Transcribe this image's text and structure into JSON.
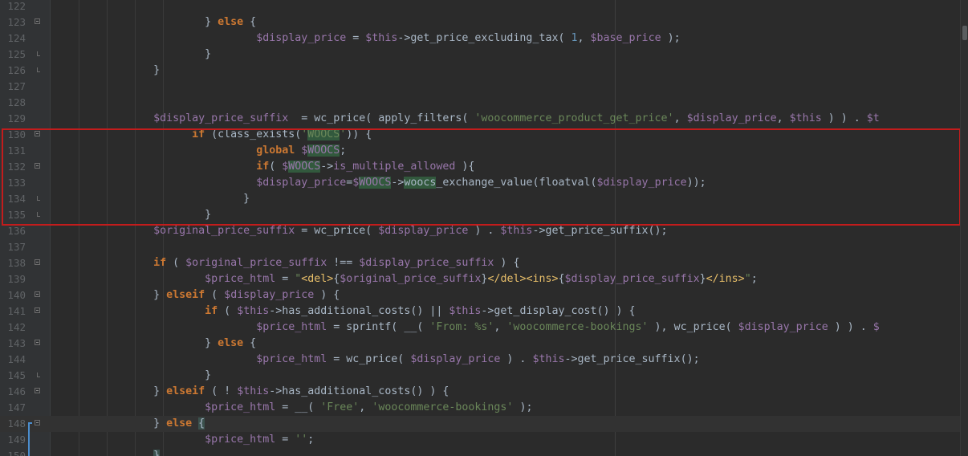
{
  "editor": {
    "lines": [
      {
        "n": "122",
        "fold": "none",
        "current": false,
        "tokens": []
      },
      {
        "n": "123",
        "fold": "start",
        "current": false,
        "tokens": [
          {
            "t": "                        } "
          },
          {
            "t": "else",
            "c": "kw"
          },
          {
            "t": " {"
          }
        ]
      },
      {
        "n": "124",
        "fold": "none",
        "current": false,
        "tokens": [
          {
            "t": "                                "
          },
          {
            "t": "$display_price",
            "c": "var"
          },
          {
            "t": " = "
          },
          {
            "t": "$this",
            "c": "var"
          },
          {
            "t": "->get_price_excluding_tax( "
          },
          {
            "t": "1",
            "c": "num"
          },
          {
            "t": ", "
          },
          {
            "t": "$base_price",
            "c": "var"
          },
          {
            "t": " );"
          }
        ]
      },
      {
        "n": "125",
        "fold": "end",
        "current": false,
        "tokens": [
          {
            "t": "                        }"
          }
        ]
      },
      {
        "n": "126",
        "fold": "end",
        "current": false,
        "tokens": [
          {
            "t": "                }"
          }
        ]
      },
      {
        "n": "127",
        "fold": "none",
        "current": false,
        "tokens": []
      },
      {
        "n": "128",
        "fold": "none",
        "current": false,
        "tokens": []
      },
      {
        "n": "129",
        "fold": "none",
        "current": false,
        "tokens": [
          {
            "t": "                "
          },
          {
            "t": "$display_price_suffix",
            "c": "var"
          },
          {
            "t": "  = wc_price( apply_filters( "
          },
          {
            "t": "'woocommerce_product_get_price'",
            "c": "str"
          },
          {
            "t": ", "
          },
          {
            "t": "$display_price",
            "c": "var"
          },
          {
            "t": ", "
          },
          {
            "t": "$this",
            "c": "var"
          },
          {
            "t": " ) ) . "
          },
          {
            "t": "$t",
            "c": "var"
          }
        ]
      },
      {
        "n": "130",
        "fold": "start",
        "current": false,
        "tokens": [
          {
            "t": "                      "
          },
          {
            "t": "if",
            "c": "kw"
          },
          {
            "t": " (class_exists("
          },
          {
            "t": "'",
            "c": "str"
          },
          {
            "t": "WOOCS",
            "c": "str hl"
          },
          {
            "t": "'",
            "c": "str"
          },
          {
            "t": ")) {"
          }
        ]
      },
      {
        "n": "131",
        "fold": "none",
        "current": false,
        "tokens": [
          {
            "t": "                                "
          },
          {
            "t": "global",
            "c": "kw"
          },
          {
            "t": " "
          },
          {
            "t": "$",
            "c": "var"
          },
          {
            "t": "WOOCS",
            "c": "var hl"
          },
          {
            "t": ";"
          }
        ]
      },
      {
        "n": "132",
        "fold": "start",
        "current": false,
        "tokens": [
          {
            "t": "                                "
          },
          {
            "t": "if",
            "c": "kw"
          },
          {
            "t": "( "
          },
          {
            "t": "$",
            "c": "var"
          },
          {
            "t": "WOOCS",
            "c": "var hl"
          },
          {
            "t": "->"
          },
          {
            "t": "is_multiple_allowed",
            "c": "var"
          },
          {
            "t": " ){"
          }
        ]
      },
      {
        "n": "133",
        "fold": "none",
        "current": false,
        "tokens": [
          {
            "t": "                                "
          },
          {
            "t": "$display_price",
            "c": "var"
          },
          {
            "t": "="
          },
          {
            "t": "$",
            "c": "var"
          },
          {
            "t": "WOOCS",
            "c": "var hl"
          },
          {
            "t": "->"
          },
          {
            "t": "woocs",
            "c": "hl"
          },
          {
            "t": "_exchange_value(floatval("
          },
          {
            "t": "$display_price",
            "c": "var"
          },
          {
            "t": "));"
          }
        ]
      },
      {
        "n": "134",
        "fold": "end",
        "current": false,
        "tokens": [
          {
            "t": "                              }"
          }
        ]
      },
      {
        "n": "135",
        "fold": "end",
        "current": false,
        "tokens": [
          {
            "t": "                        }"
          }
        ]
      },
      {
        "n": "136",
        "fold": "none",
        "current": false,
        "tokens": [
          {
            "t": "                "
          },
          {
            "t": "$original_price_suffix",
            "c": "var"
          },
          {
            "t": " = wc_price( "
          },
          {
            "t": "$display_price",
            "c": "var"
          },
          {
            "t": " ) . "
          },
          {
            "t": "$this",
            "c": "var"
          },
          {
            "t": "->get_price_suffix();"
          }
        ]
      },
      {
        "n": "137",
        "fold": "none",
        "current": false,
        "tokens": []
      },
      {
        "n": "138",
        "fold": "start",
        "current": false,
        "tokens": [
          {
            "t": "                "
          },
          {
            "t": "if",
            "c": "kw"
          },
          {
            "t": " ( "
          },
          {
            "t": "$original_price_suffix",
            "c": "var"
          },
          {
            "t": " !== "
          },
          {
            "t": "$display_price_suffix",
            "c": "var"
          },
          {
            "t": " ) {"
          }
        ]
      },
      {
        "n": "139",
        "fold": "none",
        "current": false,
        "tokens": [
          {
            "t": "                        "
          },
          {
            "t": "$price_html",
            "c": "var"
          },
          {
            "t": " = "
          },
          {
            "t": "\"",
            "c": "str"
          },
          {
            "t": "<del>",
            "c": "tag"
          },
          {
            "t": "{"
          },
          {
            "t": "$original_price_suffix",
            "c": "var"
          },
          {
            "t": "}"
          },
          {
            "t": "</del><ins>",
            "c": "tag"
          },
          {
            "t": "{"
          },
          {
            "t": "$display_price_suffix",
            "c": "var"
          },
          {
            "t": "}"
          },
          {
            "t": "</ins>",
            "c": "tag"
          },
          {
            "t": "\"",
            "c": "str"
          },
          {
            "t": ";"
          }
        ]
      },
      {
        "n": "140",
        "fold": "start",
        "current": false,
        "tokens": [
          {
            "t": "                } "
          },
          {
            "t": "elseif",
            "c": "kw"
          },
          {
            "t": " ( "
          },
          {
            "t": "$display_price",
            "c": "var"
          },
          {
            "t": " ) {"
          }
        ]
      },
      {
        "n": "141",
        "fold": "start",
        "current": false,
        "tokens": [
          {
            "t": "                        "
          },
          {
            "t": "if",
            "c": "kw"
          },
          {
            "t": " ( "
          },
          {
            "t": "$this",
            "c": "var"
          },
          {
            "t": "->has_additional_costs() || "
          },
          {
            "t": "$this",
            "c": "var"
          },
          {
            "t": "->get_display_cost() ) {"
          }
        ]
      },
      {
        "n": "142",
        "fold": "none",
        "current": false,
        "tokens": [
          {
            "t": "                                "
          },
          {
            "t": "$price_html",
            "c": "var"
          },
          {
            "t": " = sprintf( __( "
          },
          {
            "t": "'From: %s'",
            "c": "str"
          },
          {
            "t": ", "
          },
          {
            "t": "'woocommerce-bookings'",
            "c": "str"
          },
          {
            "t": " ), wc_price( "
          },
          {
            "t": "$display_price",
            "c": "var"
          },
          {
            "t": " ) ) . "
          },
          {
            "t": "$",
            "c": "var"
          }
        ]
      },
      {
        "n": "143",
        "fold": "start",
        "current": false,
        "tokens": [
          {
            "t": "                        } "
          },
          {
            "t": "else",
            "c": "kw"
          },
          {
            "t": " {"
          }
        ]
      },
      {
        "n": "144",
        "fold": "none",
        "current": false,
        "tokens": [
          {
            "t": "                                "
          },
          {
            "t": "$price_html",
            "c": "var"
          },
          {
            "t": " = wc_price( "
          },
          {
            "t": "$display_price",
            "c": "var"
          },
          {
            "t": " ) . "
          },
          {
            "t": "$this",
            "c": "var"
          },
          {
            "t": "->get_price_suffix();"
          }
        ]
      },
      {
        "n": "145",
        "fold": "end",
        "current": false,
        "tokens": [
          {
            "t": "                        }"
          }
        ]
      },
      {
        "n": "146",
        "fold": "start",
        "current": false,
        "tokens": [
          {
            "t": "                } "
          },
          {
            "t": "elseif",
            "c": "kw"
          },
          {
            "t": " ( ! "
          },
          {
            "t": "$this",
            "c": "var"
          },
          {
            "t": "->has_additional_costs() ) {"
          }
        ]
      },
      {
        "n": "147",
        "fold": "none",
        "current": false,
        "tokens": [
          {
            "t": "                        "
          },
          {
            "t": "$price_html",
            "c": "var"
          },
          {
            "t": " = __( "
          },
          {
            "t": "'Free'",
            "c": "str"
          },
          {
            "t": ", "
          },
          {
            "t": "'woocommerce-bookings'",
            "c": "str"
          },
          {
            "t": " );"
          }
        ]
      },
      {
        "n": "148",
        "fold": "start",
        "current": true,
        "tokens": [
          {
            "t": "                } "
          },
          {
            "t": "else",
            "c": "kw"
          },
          {
            "t": " "
          },
          {
            "t": "{",
            "c": "bm"
          }
        ]
      },
      {
        "n": "149",
        "fold": "none",
        "current": false,
        "tokens": [
          {
            "t": "                        "
          },
          {
            "t": "$price_html",
            "c": "var"
          },
          {
            "t": " = "
          },
          {
            "t": "''",
            "c": "str"
          },
          {
            "t": ";"
          }
        ]
      },
      {
        "n": "150",
        "fold": "none",
        "current": false,
        "tokens": [
          {
            "t": "                "
          },
          {
            "t": "}",
            "c": "bm"
          }
        ]
      }
    ]
  },
  "colors": {
    "background": "#2b2b2b",
    "gutter": "#313335",
    "keyword": "#cc7832",
    "variable": "#9876aa",
    "string": "#6a8759",
    "number": "#6897bb",
    "highlight_box": "#c31c1c"
  }
}
